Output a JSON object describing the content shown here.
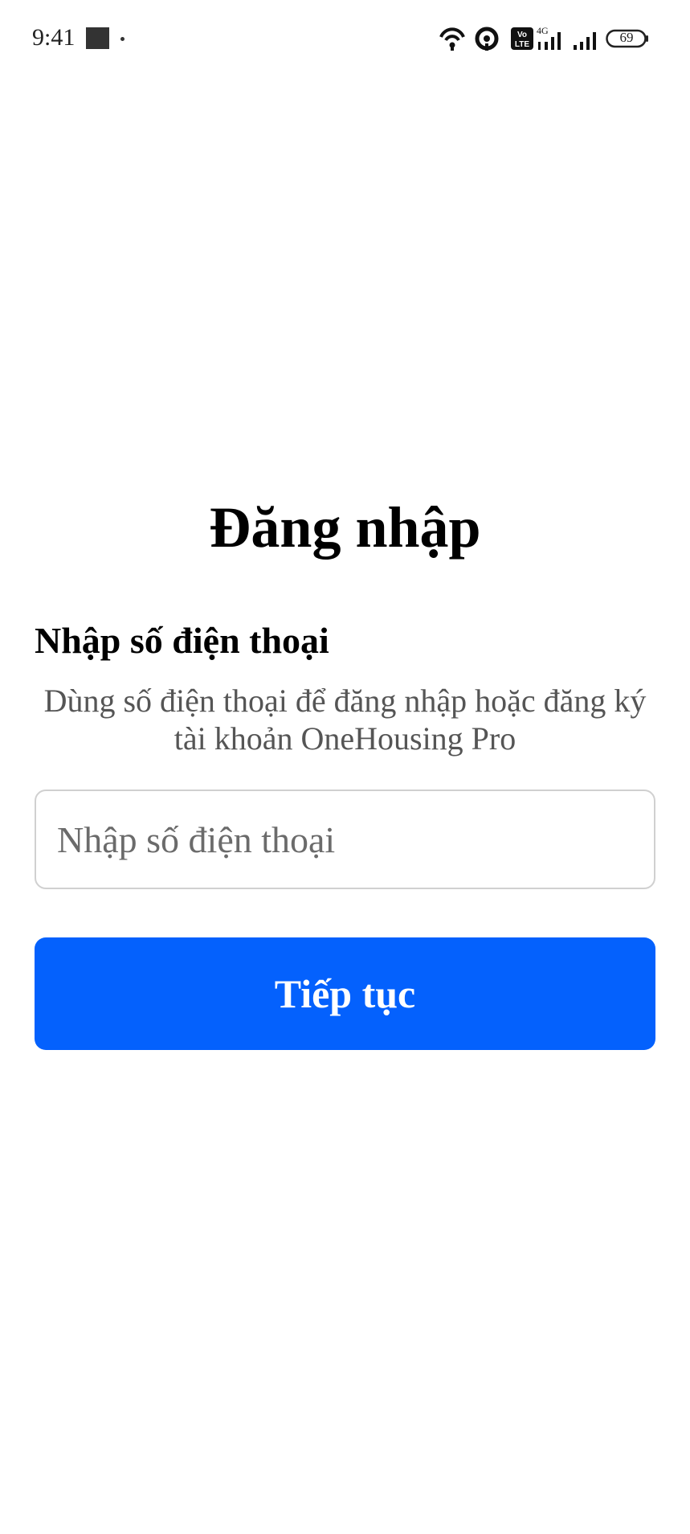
{
  "status_bar": {
    "time": "9:41",
    "battery_level": "69",
    "network_label": "4G",
    "volte_label": "Vo LTE",
    "icons": [
      "hotspot-icon",
      "wireless-icon",
      "volte-icon",
      "signal-icon",
      "signal-icon",
      "battery-icon"
    ]
  },
  "login": {
    "title": "Đăng nhập",
    "section_heading": "Nhập số điện thoại",
    "description": "Dùng số điện thoại để đăng nhập hoặc đăng ký tài khoản OneHousing Pro",
    "phone_input": {
      "value": "",
      "placeholder": "Nhập số điện thoại"
    },
    "continue_label": "Tiếp tục"
  },
  "colors": {
    "primary": "#0461fd",
    "text": "#000000",
    "muted_text": "#555555",
    "input_border": "#d0d0d0"
  }
}
